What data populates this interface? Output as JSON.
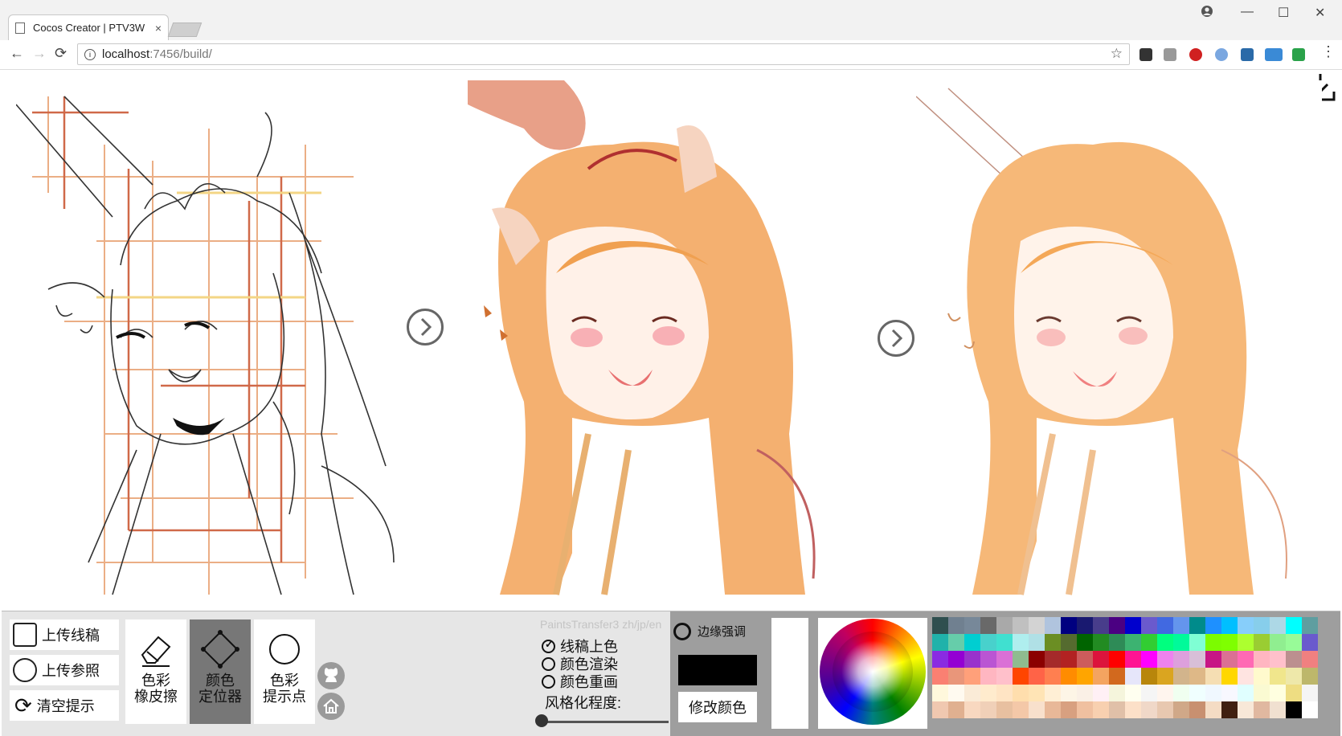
{
  "browser": {
    "tab_title": "Cocos Creator | PTV3W",
    "tab_close": "×",
    "url_host": "localhost",
    "url_path": ":7456/build/",
    "window_controls": [
      "—",
      "☐",
      "✕"
    ]
  },
  "toolbar": {
    "upload_lineart": "上传线稿",
    "upload_reference": "上传参照",
    "clear_hints": "清空提示",
    "color_eraser_line1": "色彩",
    "color_eraser_line2": "橡皮擦",
    "color_locator_line1": "颜色",
    "color_locator_line2": "定位器",
    "color_hint_line1": "色彩",
    "color_hint_line2": "提示点"
  },
  "options": {
    "brand": "PaintsTransfer3 zh/jp/en",
    "mode_line_coloring": "线稿上色",
    "mode_color_render": "颜色渲染",
    "mode_color_repaint": "颜色重画",
    "mode_selected_index": 0,
    "style_degree_label": "风格化程度:",
    "style_degree_value": 0,
    "edge_enhance": "边缘强调",
    "modify_color": "修改颜色",
    "current_color": "#000000"
  },
  "palette": [
    "#2f4f4f",
    "#708090",
    "#778899",
    "#696969",
    "#a9a9a9",
    "#c0c0c0",
    "#d3d3d3",
    "#b0c4de",
    "#000080",
    "#191970",
    "#483d8b",
    "#4b0082",
    "#0000cd",
    "#6a5acd",
    "#4169e1",
    "#6495ed",
    "#008b8b",
    "#1e90ff",
    "#00bfff",
    "#87cefa",
    "#87ceeb",
    "#add8e6",
    "#00ffff",
    "#5f9ea0",
    "#20b2aa",
    "#66cdaa",
    "#00ced1",
    "#48d1cc",
    "#40e0d0",
    "#afeeee",
    "#b0e0e6",
    "#6b8e23",
    "#556b2f",
    "#006400",
    "#228b22",
    "#2e8b57",
    "#3cb371",
    "#32cd32",
    "#00ff7f",
    "#00fa9a",
    "#7fffd4",
    "#7cfc00",
    "#7fff00",
    "#adff2f",
    "#9acd32",
    "#90ee90",
    "#98fb98",
    "#6a5acd",
    "#8a2be2",
    "#9400d3",
    "#9932cc",
    "#ba55d3",
    "#da70d6",
    "#8fbc8f",
    "#8b0000",
    "#a52a2a",
    "#b22222",
    "#cd5c5c",
    "#dc143c",
    "#ff0000",
    "#ff1493",
    "#ff00ff",
    "#ee82ee",
    "#dda0dd",
    "#d8bfd8",
    "#c71585",
    "#db7093",
    "#ff69b4",
    "#ffb6c1",
    "#ffc0cb",
    "#bc8f8f",
    "#f08080",
    "#fa8072",
    "#e9967a",
    "#ffa07a",
    "#ffb6c1",
    "#ffc0cb",
    "#ff4500",
    "#ff6347",
    "#ff7f50",
    "#ff8c00",
    "#ffa500",
    "#f4a460",
    "#d2691e",
    "#e6e6fa",
    "#b8860b",
    "#daa520",
    "#d2b48c",
    "#deb887",
    "#f5deb3",
    "#ffd700",
    "#ffe4e1",
    "#fffacd",
    "#f0e68c",
    "#eee8aa",
    "#bdb76b",
    "#fff8dc",
    "#fffaf0",
    "#faebd7",
    "#ffebcd",
    "#ffe4c4",
    "#ffdead",
    "#ffe4b5",
    "#ffefd5",
    "#fdf5e6",
    "#faf0e6",
    "#fff0f5",
    "#f5f5dc",
    "#fffff0",
    "#f5f5f5",
    "#fff5ee",
    "#f0fff0",
    "#f0ffff",
    "#f0f8ff",
    "#f8f8ff",
    "#e0ffff",
    "#fafad2",
    "#ffffe0",
    "#eedd82",
    "#f5f5f5",
    "#f0c8b0",
    "#e0b090",
    "#f8d8c0",
    "#f0d0b8",
    "#e8c0a0",
    "#f4c8a8",
    "#f8e0cc",
    "#e8b898",
    "#d8a080",
    "#f0c0a0",
    "#f8d0b0",
    "#e0c0a8",
    "#fce0c8",
    "#f0d8c8",
    "#e8c8b0",
    "#d0a888",
    "#c89070",
    "#f4dcc4",
    "#402010",
    "#f8e8d8",
    "#e0b8a0",
    "#f0e0d0",
    "#000000",
    "#ffffff"
  ]
}
